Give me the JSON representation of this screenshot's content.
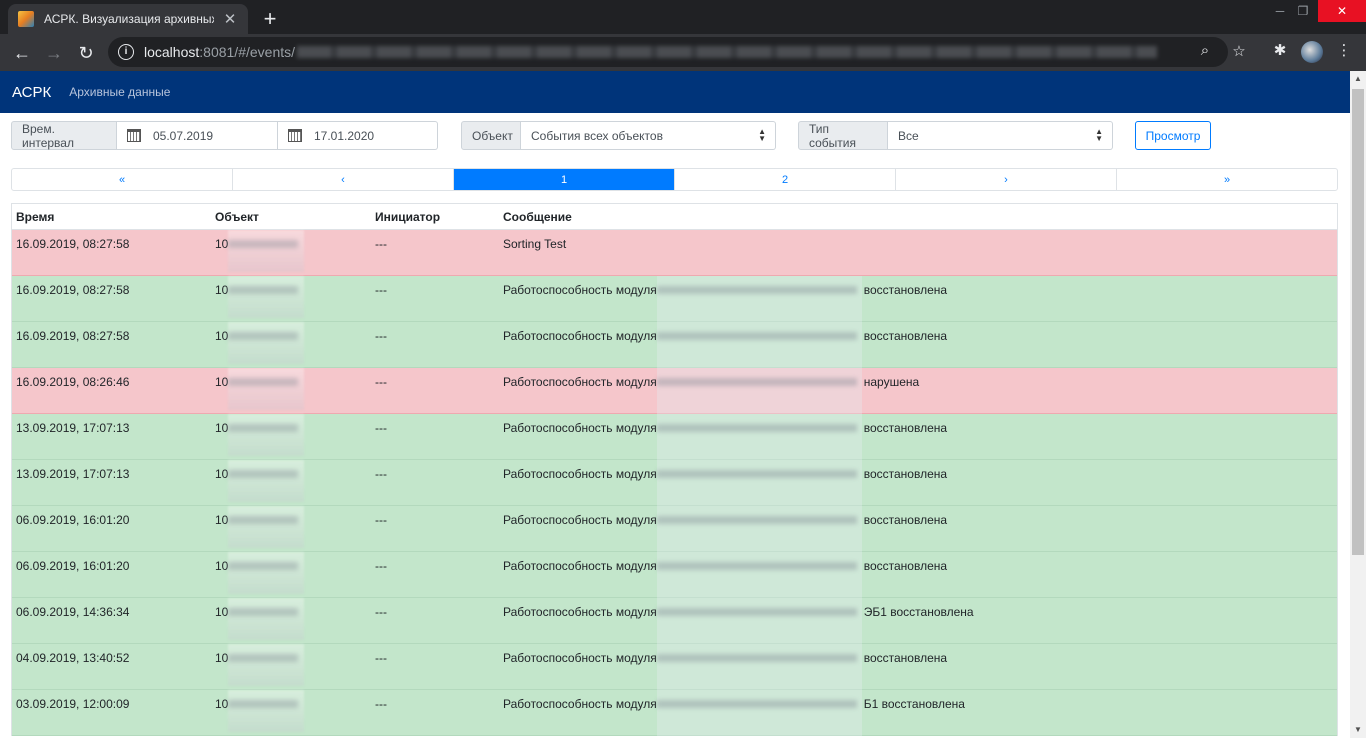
{
  "browser": {
    "tab_title": "АСРК. Визуализация архивных д",
    "url_host": "localhost",
    "url_rest": ":8081/#/events/"
  },
  "navbar": {
    "brand": "АСРК",
    "link": "Архивные данные"
  },
  "filters": {
    "interval_label": "Врем. интервал",
    "date_from": "05.07.2019",
    "date_to": "17.01.2020",
    "object_label": "Объект",
    "object_value": "События всех объектов",
    "type_label": "Тип события",
    "type_value": "Все",
    "view_button": "Просмотр"
  },
  "pagination": [
    "«",
    "‹",
    "1",
    "2",
    "›",
    "»"
  ],
  "table": {
    "headers": [
      "Время",
      "Объект",
      "Инициатор",
      "Сообщение"
    ],
    "rows": [
      {
        "time": "16.09.2019, 08:27:58",
        "obj": "10",
        "init": "---",
        "msg_start": "Sorting Test",
        "msg_end": ""
      },
      {
        "time": "16.09.2019, 08:27:58",
        "obj": "10",
        "init": "---",
        "msg_start": "Работоспособность модуля",
        "msg_end": "восстановлена"
      },
      {
        "time": "16.09.2019, 08:27:58",
        "obj": "10",
        "init": "---",
        "msg_start": "Работоспособность модуля",
        "msg_end": "восстановлена"
      },
      {
        "time": "16.09.2019, 08:26:46",
        "obj": "10",
        "init": "---",
        "msg_start": "Работоспособность модуля",
        "msg_end": "нарушена"
      },
      {
        "time": "13.09.2019, 17:07:13",
        "obj": "10",
        "init": "---",
        "msg_start": "Работоспособность модуля",
        "msg_end": "восстановлена"
      },
      {
        "time": "13.09.2019, 17:07:13",
        "obj": "10",
        "init": "---",
        "msg_start": "Работоспособность модуля",
        "msg_end": "восстановлена"
      },
      {
        "time": "06.09.2019, 16:01:20",
        "obj": "10",
        "init": "---",
        "msg_start": "Работоспособность модуля",
        "msg_end": "восстановлена"
      },
      {
        "time": "06.09.2019, 16:01:20",
        "obj": "10",
        "init": "---",
        "msg_start": "Работоспособность модуля",
        "msg_end": "восстановлена"
      },
      {
        "time": "06.09.2019, 14:36:34",
        "obj": "10",
        "init": "---",
        "msg_start": "Работоспособность модуля",
        "msg_end": "ЭБ1 восстановлена"
      },
      {
        "time": "04.09.2019, 13:40:52",
        "obj": "10",
        "init": "---",
        "msg_start": "Работоспособность модуля",
        "msg_end": "восстановлена"
      },
      {
        "time": "03.09.2019, 12:00:09",
        "obj": "10",
        "init": "---",
        "msg_start": "Работоспособность модуля",
        "msg_end": "Б1 восстановлена"
      }
    ]
  },
  "colors": {
    "navbar": "#00347a",
    "success_row": "#c3e6cb",
    "danger_row": "#f5c6cb",
    "accent": "#007bff"
  }
}
